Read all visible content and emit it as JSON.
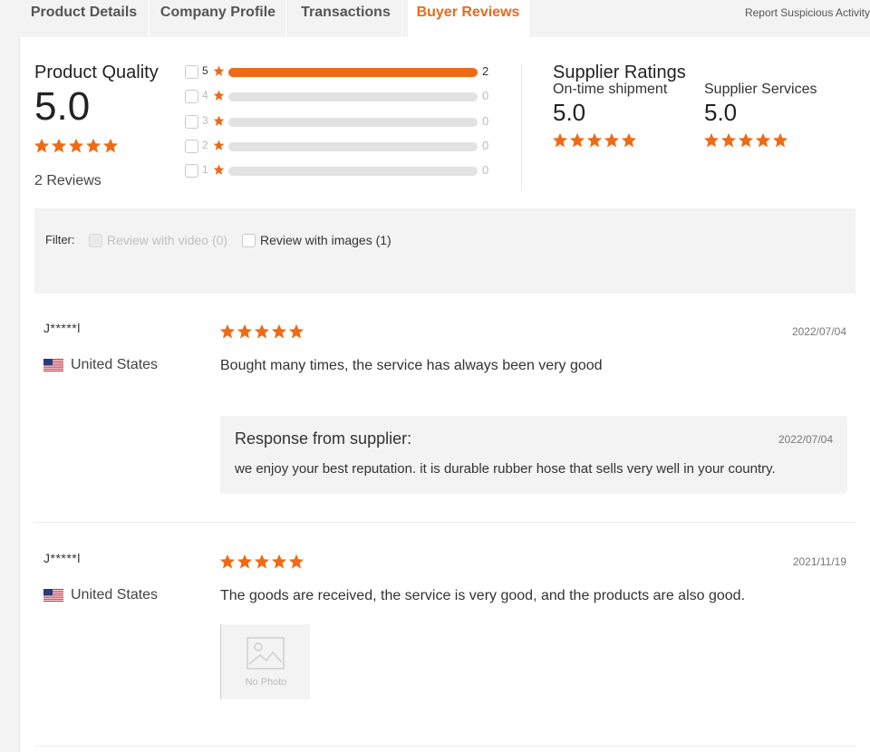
{
  "tabs": [
    {
      "label": "Product Details",
      "active": false
    },
    {
      "label": "Company Profile",
      "active": false
    },
    {
      "label": "Transactions",
      "active": false
    },
    {
      "label": "Buyer Reviews",
      "active": true
    }
  ],
  "report_link": "Report Suspicious Activity",
  "product_quality": {
    "title": "Product Quality",
    "score": "5.0",
    "stars": 5,
    "reviews_count": "2 Reviews"
  },
  "distribution": [
    {
      "level": "5",
      "count": "2",
      "fraction": 1.0
    },
    {
      "level": "4",
      "count": "0",
      "fraction": 0
    },
    {
      "level": "3",
      "count": "0",
      "fraction": 0
    },
    {
      "level": "2",
      "count": "0",
      "fraction": 0
    },
    {
      "level": "1",
      "count": "0",
      "fraction": 0
    }
  ],
  "supplier_ratings": {
    "title": "Supplier Ratings",
    "items": [
      {
        "label": "On-time shipment",
        "score": "5.0",
        "stars": 5
      },
      {
        "label": "Supplier Services",
        "score": "5.0",
        "stars": 5
      }
    ]
  },
  "filter": {
    "label": "Filter:",
    "options": [
      {
        "label": "Review with video (0)",
        "disabled": true
      },
      {
        "label": "Review with images (1)",
        "disabled": false
      }
    ]
  },
  "reviews": [
    {
      "reviewer": "J*****l",
      "country": "United States",
      "stars": 5,
      "date": "2022/07/04",
      "text": "Bought many times, the service has always been very good",
      "response": {
        "title": "Response from supplier:",
        "date": "2022/07/04",
        "text": "we enjoy your best reputation. it is durable rubber hose that sells very well in your country."
      }
    },
    {
      "reviewer": "J*****l",
      "country": "United States",
      "stars": 5,
      "date": "2021/11/19",
      "text": "The goods are received, the service is very good, and the products are also good.",
      "photo_placeholder": "No Photo"
    }
  ],
  "colors": {
    "accent": "#e56b1f",
    "star": "#ee6a15",
    "bar_track": "#e2e2e2"
  }
}
